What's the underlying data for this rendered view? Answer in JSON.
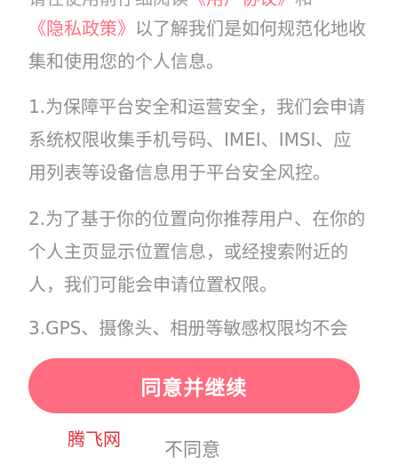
{
  "clipped_line": {
    "prefix": "请在使用前仔细阅读",
    "link": "《用户协议》",
    "suffix": "和"
  },
  "policy_intro": {
    "link": "《隐私政策》",
    "text": "以了解我们是如何规范化地收集和使用您的个人信息。"
  },
  "items": [
    "1.为保障平台安全和运营安全，我们会申请系统权限收集手机号码、IMEI、IMSI、应用列表等设备信息用于平台安全风控。",
    "2.为了基于你的位置向你推荐用户、在你的个人主页显示位置信息，或经搜索附近的人，我们可能会申请位置权限。",
    "3.GPS、摄像头、相册等敏感权限均不会"
  ],
  "agree_button": "同意并继续",
  "disagree_button": "不同意",
  "watermark": "腾飞网",
  "colors": {
    "accent": "#ff6b7f",
    "link": "#ff6f83",
    "body_text": "#8e8e8e",
    "watermark": "#e0303a"
  }
}
